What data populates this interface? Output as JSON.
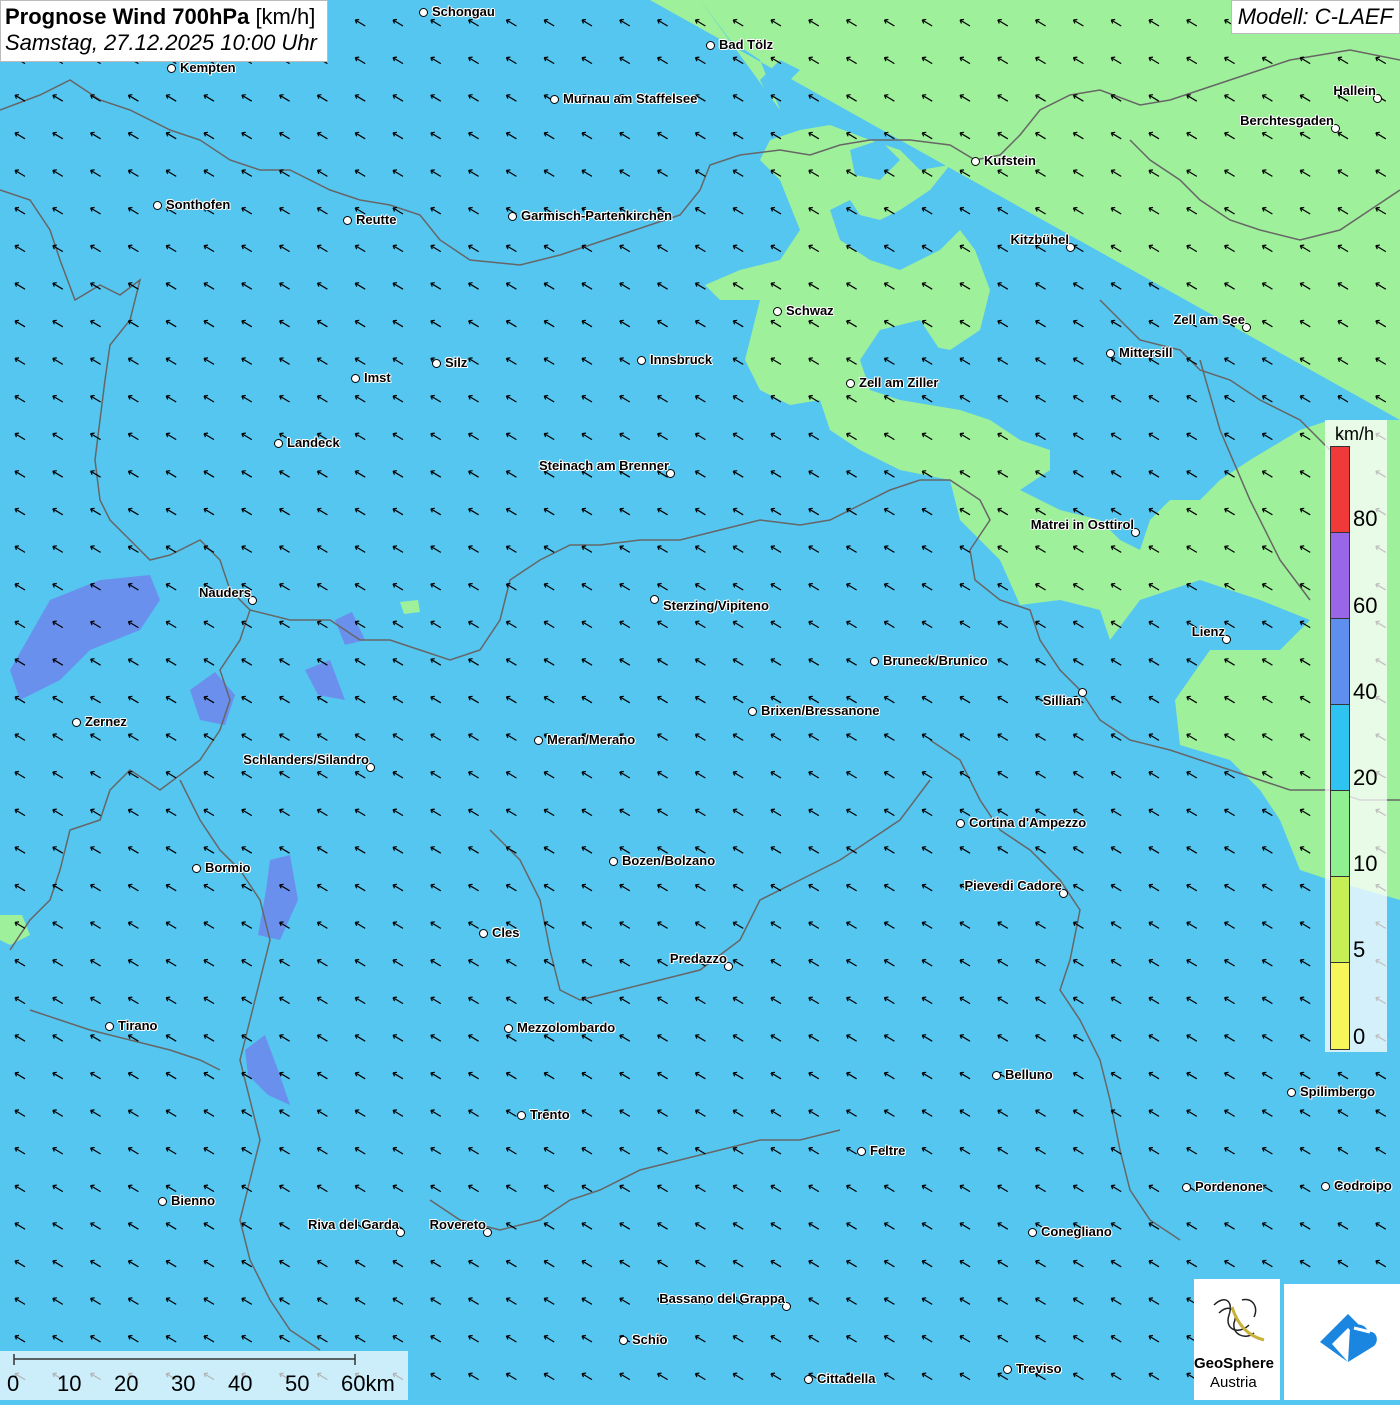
{
  "title": {
    "main_bold": "Prognose Wind 700hPa",
    "main_unit": "[km/h]",
    "subtitle": "Samstag, 27.12.2025 10:00 Uhr"
  },
  "model": "Modell: C-LAEF",
  "legend": {
    "unit": "km/h",
    "labels": [
      "80",
      "60",
      "40",
      "20",
      "10",
      "5",
      "0"
    ],
    "colors": [
      "#f03a3a",
      "#9a66e8",
      "#5f8fee",
      "#2ec3f0",
      "#8ff08f",
      "#c6ef55",
      "#f6f55a"
    ]
  },
  "colors": {
    "wind_10_20": "#55c6f0",
    "wind_0_10": "#9ff09a",
    "wind_40_60": "#6f86ec",
    "border": "#666666"
  },
  "scale": {
    "labels": [
      "0",
      "10",
      "20",
      "30",
      "40",
      "50",
      "60km"
    ]
  },
  "logos": {
    "geosphere_line1": "GeoSphere",
    "geosphere_line2": "Austria"
  },
  "cities": [
    {
      "name": "Schongau"
    },
    {
      "name": "Kempten"
    },
    {
      "name": "Bad Tölz"
    },
    {
      "name": "Murnau am Staffelsee"
    },
    {
      "name": "Hallein"
    },
    {
      "name": "Berchtesgaden"
    },
    {
      "name": "Kufstein"
    },
    {
      "name": "Sonthofen"
    },
    {
      "name": "Reutte"
    },
    {
      "name": "Garmisch-Partenkirchen"
    },
    {
      "name": "Kitzbühel"
    },
    {
      "name": "Schwaz"
    },
    {
      "name": "Zell am See"
    },
    {
      "name": "Mittersill"
    },
    {
      "name": "Silz"
    },
    {
      "name": "Innsbruck"
    },
    {
      "name": "Imst"
    },
    {
      "name": "Zell am Ziller"
    },
    {
      "name": "Landeck"
    },
    {
      "name": "Steinach am Brenner"
    },
    {
      "name": "Matrei in Osttirol"
    },
    {
      "name": "Nauders"
    },
    {
      "name": "Sterzing/Vipiteno"
    },
    {
      "name": "Lienz"
    },
    {
      "name": "Bruneck/Brunico"
    },
    {
      "name": "Sillian"
    },
    {
      "name": "Zernez"
    },
    {
      "name": "Brixen/Bressanone"
    },
    {
      "name": "Meran/Merano"
    },
    {
      "name": "Schlanders/Silandro"
    },
    {
      "name": "Cortina d'Ampezzo"
    },
    {
      "name": "Bozen/Bolzano"
    },
    {
      "name": "Bormio"
    },
    {
      "name": "Pieve di Cadore"
    },
    {
      "name": "Cles"
    },
    {
      "name": "Predazzo"
    },
    {
      "name": "Tirano"
    },
    {
      "name": "Mezzolombardo"
    },
    {
      "name": "Belluno"
    },
    {
      "name": "Spilimbergo"
    },
    {
      "name": "Trento"
    },
    {
      "name": "Feltre"
    },
    {
      "name": "Pordenone"
    },
    {
      "name": "Codroipo"
    },
    {
      "name": "Bienno"
    },
    {
      "name": "Riva del Garda"
    },
    {
      "name": "Rovereto"
    },
    {
      "name": "Conegliano"
    },
    {
      "name": "Bassano del Grappa"
    },
    {
      "name": "Schio"
    },
    {
      "name": "Treviso"
    },
    {
      "name": "Cittadella"
    }
  ]
}
